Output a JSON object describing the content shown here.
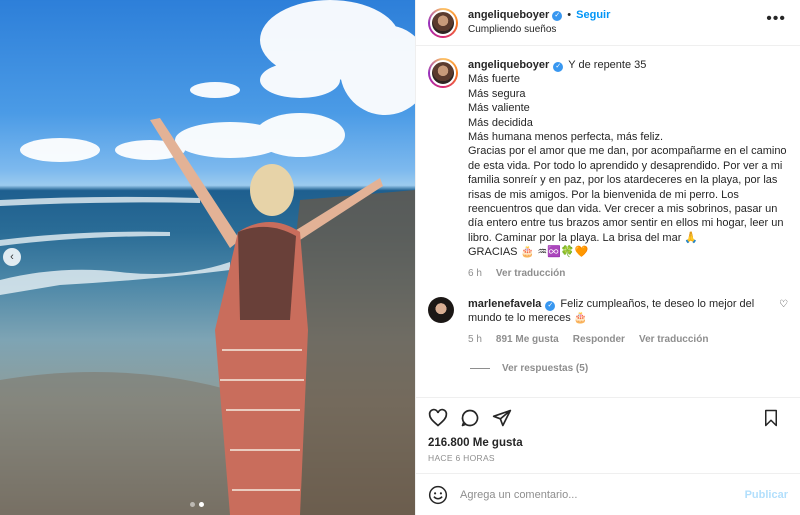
{
  "post": {
    "username": "angeliqueboyer",
    "follow_label": "Seguir",
    "subtitle": "Cumpliendo sueños",
    "more_label": "•••",
    "nav_prev": "‹"
  },
  "caption": {
    "username": "angeliqueboyer",
    "lines": [
      "Y de repente 35",
      "Más fuerte",
      "Más segura",
      "Más valiente",
      "Más decidida",
      "Más humana menos perfecta, más feliz.",
      "Gracias por el amor que me dan, por acompañarme en el camino de esta vida. Por todo lo aprendido y desaprendido. Por ver a mi familia sonreír y en paz, por los atardeceres en la playa, por las risas de mis amigos. Por la bienvenida de mi perro. Los reencuentros que dan vida. Ver crecer a mis sobrinos, pasar un día entero entre tus brazos amor sentir en ellos mi hogar, leer un libro. Caminar por la playa. La brisa del mar 🙏",
      "GRACIAS 🎂 ♒♾️🍀🧡"
    ],
    "time": "6 h",
    "translate": "Ver traducción"
  },
  "comment": {
    "username": "marlenefavela",
    "text": "Feliz cumpleaños, te deseo lo mejor del mundo te lo mereces 🎂",
    "time": "5 h",
    "likes": "891 Me gusta",
    "reply": "Responder",
    "translate": "Ver traducción",
    "heart": "♡"
  },
  "replies_label": "Ver respuestas (5)",
  "likes_count": "216.800 Me gusta",
  "timestamp": "HACE 6 HORAS",
  "add_comment": {
    "placeholder": "Agrega un comentario...",
    "publish": "Publicar"
  },
  "colors": {
    "accent": "#0095f6",
    "verified": "#3897f0",
    "muted": "#8e8e8e"
  }
}
